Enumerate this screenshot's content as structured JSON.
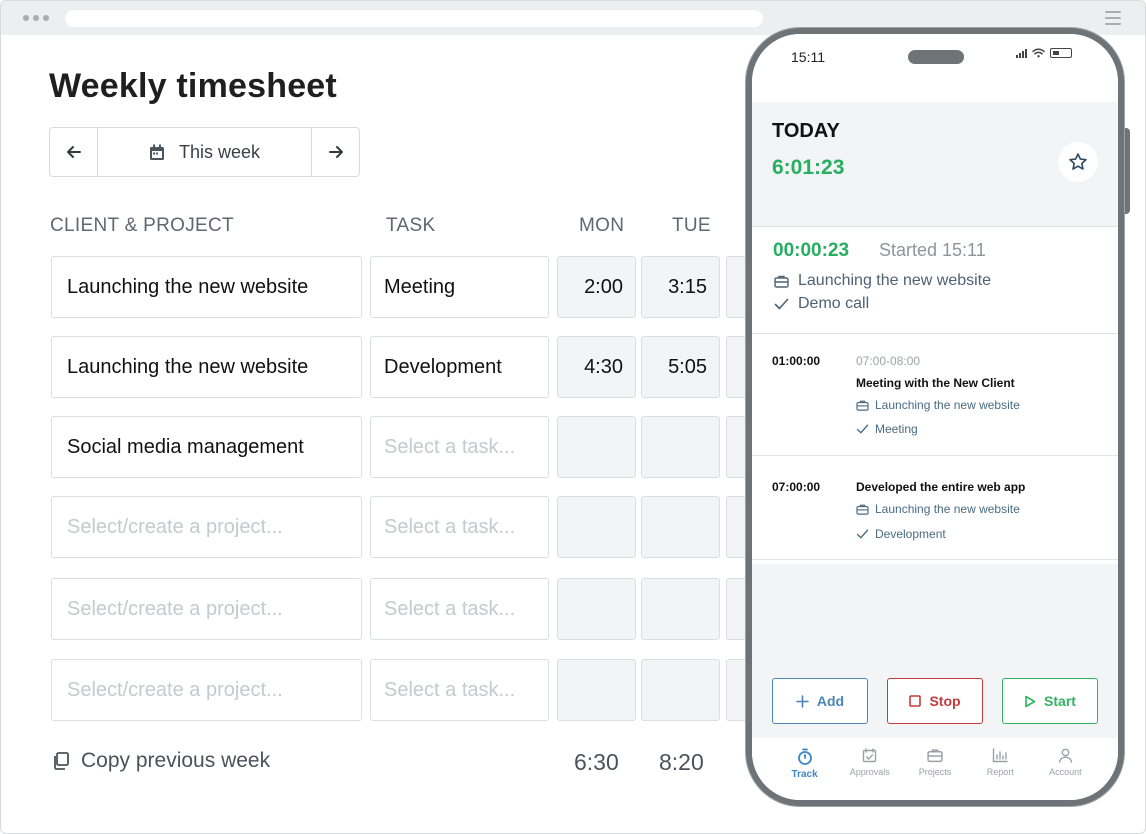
{
  "page": {
    "title": "Weekly timesheet",
    "week_nav": {
      "label": "This week"
    },
    "columns": {
      "project": "CLIENT & PROJECT",
      "task": "TASK",
      "mon": "MON",
      "tue": "TUE"
    },
    "rows": [
      {
        "project": "Launching the new website",
        "task": "Meeting",
        "mon": "2:00",
        "tue": "3:15"
      },
      {
        "project": "Launching the new website",
        "task": "Development",
        "mon": "4:30",
        "tue": "5:05"
      },
      {
        "project": "Social media management",
        "task_placeholder": "Select a task...",
        "mon": "",
        "tue": ""
      },
      {
        "project_placeholder": "Select/create a project...",
        "task_placeholder": "Select a task...",
        "mon": "",
        "tue": ""
      },
      {
        "project_placeholder": "Select/create a project...",
        "task_placeholder": "Select a task...",
        "mon": "",
        "tue": ""
      },
      {
        "project_placeholder": "Select/create a project...",
        "task_placeholder": "Select a task...",
        "mon": "",
        "tue": ""
      }
    ],
    "copy_previous": "Copy previous week",
    "totals": {
      "mon": "6:30",
      "tue": "8:20"
    }
  },
  "phone": {
    "status_time": "15:11",
    "today_label": "TODAY",
    "today_total": "6:01:23",
    "running": {
      "elapsed": "00:00:23",
      "started": "Started 15:11",
      "project": "Launching the new website",
      "task": "Demo call"
    },
    "entries": [
      {
        "duration": "01:00:00",
        "range": "07:00-08:00",
        "title": "Meeting with the New Client",
        "project": "Launching the new website",
        "task": "Meeting"
      },
      {
        "duration": "07:00:00",
        "title": "Developed the entire web app",
        "project": "Launching the new website",
        "task": "Development"
      }
    ],
    "actions": {
      "add": "Add",
      "stop": "Stop",
      "start": "Start"
    },
    "tabs": [
      "Track",
      "Approvals",
      "Projects",
      "Report",
      "Account"
    ]
  },
  "colors": {
    "green": "#27ae60",
    "blue": "#3d86c6",
    "red": "#c33b3b",
    "start_green": "#2eb35f"
  }
}
